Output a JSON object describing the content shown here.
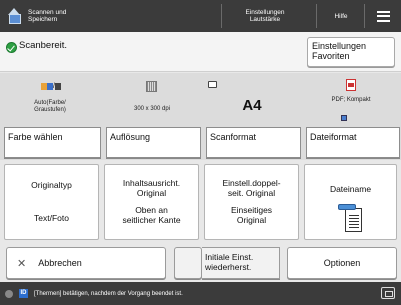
{
  "topbar": {
    "home_label_line1": "Scannen und",
    "home_label_line2": "Speichern",
    "settings_line1": "Einstellungen",
    "settings_line2": "Lautstärke",
    "help_label": "Hilfe",
    "menu_icon": "hamburger-menu-icon"
  },
  "status": {
    "text": "Scanbereit.",
    "favorites_line1": "Einstellungen",
    "favorites_line2": "Favoriten",
    "status_color": "#2ea043"
  },
  "summary": {
    "color_value_line1": "Auto(Farbe/",
    "color_value_line2": "Graustufen)",
    "resolution_value": "300 x 300 dpi",
    "format_value": "A4",
    "file_value": "PDF; Kompakt"
  },
  "tabs": {
    "color": "Farbe wählen",
    "resolution": "Auflösung",
    "scan_format": "Scanformat",
    "file_format": "Dateiformat"
  },
  "grid": {
    "original_type_label": "Originaltyp",
    "original_type_value": "Text/Foto",
    "orientation_line1": "Inhaltsausricht.",
    "orientation_line2": "Original",
    "orientation_value_line1": "Oben an",
    "orientation_value_line2": "seitlicher Kante",
    "duplex_line1": "Einstell.doppel-",
    "duplex_line2": "seit. Original",
    "duplex_value_line1": "Einseitiges",
    "duplex_value_line2": "Original",
    "filename_label": "Dateiname"
  },
  "actions": {
    "cancel": "Abbrechen",
    "reset_line1": "Initiale Einst.",
    "reset_line2": "wiederherst.",
    "options": "Optionen"
  },
  "footer": {
    "message": "[Thermen] betätigen, nachdem der Vorgang beendet ist."
  }
}
